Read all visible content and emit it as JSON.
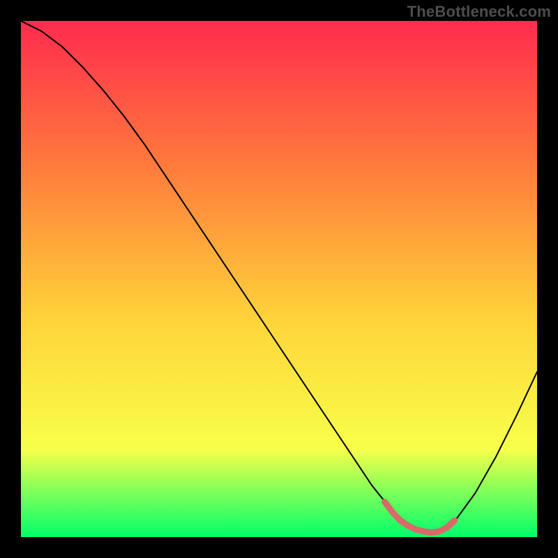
{
  "watermark": "TheBottleneck.com",
  "colors": {
    "gradient_top": "#ff2b4e",
    "gradient_upper_mid": "#ff7a3c",
    "gradient_mid": "#ffd43a",
    "gradient_lower_mid": "#f7ff4a",
    "gradient_bottom": "#00ff6a",
    "curve": "#000000",
    "markers": "#d96a6a",
    "frame_bg": "#000000"
  },
  "chart_data": {
    "type": "line",
    "title": "",
    "xlabel": "",
    "ylabel": "",
    "xlim": [
      0,
      100
    ],
    "ylim": [
      0,
      100
    ],
    "curve": {
      "x": [
        0,
        4,
        8,
        12,
        16,
        20,
        24,
        28,
        32,
        36,
        40,
        44,
        48,
        52,
        56,
        60,
        64,
        68,
        70,
        72,
        74,
        76,
        78,
        80,
        82,
        84,
        88,
        92,
        96,
        100
      ],
      "y": [
        100,
        98,
        95,
        91,
        86.5,
        81.5,
        76,
        70,
        64,
        58,
        52,
        46,
        40,
        34,
        28,
        22,
        16,
        10,
        7.5,
        5.2,
        3.4,
        2.1,
        1.2,
        0.8,
        1.3,
        3.0,
        8.5,
        15.5,
        23.5,
        32
      ]
    },
    "markers": {
      "stroke_width_px": 9,
      "x": [
        70.5,
        72.0,
        73.5,
        75.0,
        76.5,
        78.0,
        79.5,
        81.0,
        82.5,
        84.0
      ],
      "y": [
        6.8,
        4.8,
        3.2,
        2.2,
        1.5,
        1.1,
        0.9,
        1.1,
        1.8,
        3.2
      ]
    }
  }
}
